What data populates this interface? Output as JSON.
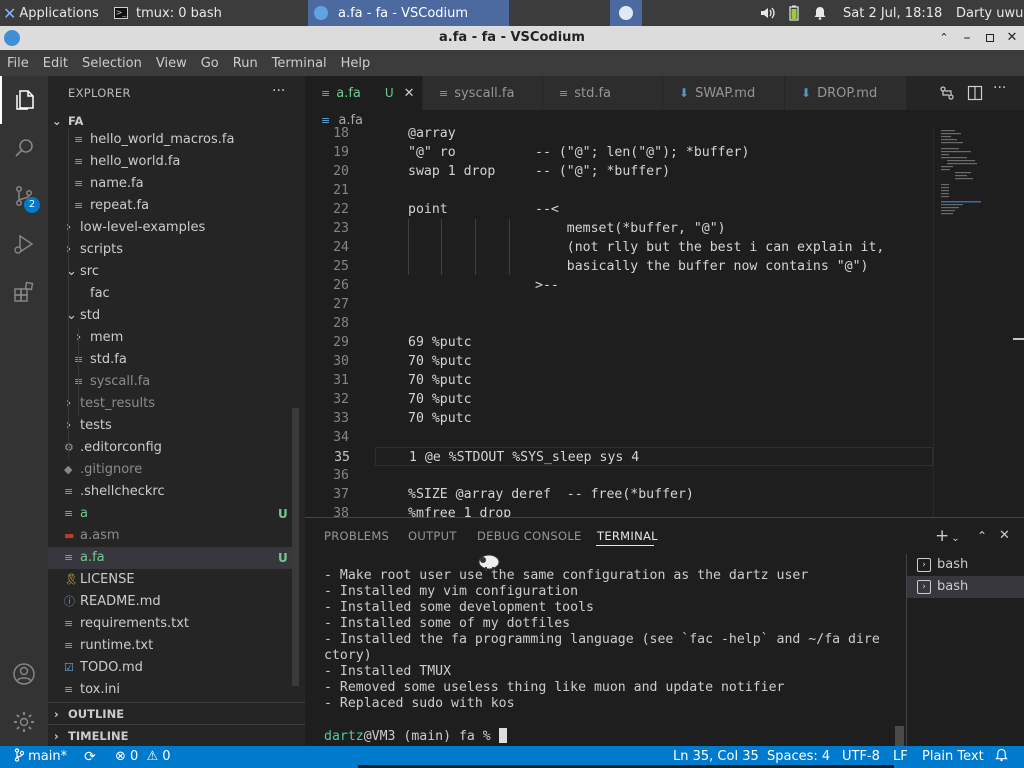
{
  "taskbar": {
    "applications_label": "Applications",
    "tmux_task": "tmux: 0 bash",
    "vscodium_task": "a.fa - fa - VSCodium",
    "datetime": "Sat  2 Jul, 18:18",
    "user": "Darty uwu"
  },
  "window": {
    "title": "a.fa - fa - VSCodium"
  },
  "menu": [
    "File",
    "Edit",
    "Selection",
    "View",
    "Go",
    "Run",
    "Terminal",
    "Help"
  ],
  "activity_bar": {
    "scm_badge": "2"
  },
  "explorer": {
    "header": "EXPLORER",
    "more": "···",
    "root": "FA",
    "items": [
      {
        "label": "hello_world_macros.fa",
        "indent": 2,
        "kind": "file",
        "icon": "list-icon",
        "color": "#cccccc",
        "badge": ""
      },
      {
        "label": "hello_world.fa",
        "indent": 2,
        "kind": "file",
        "icon": "list-icon",
        "color": "#cccccc",
        "badge": ""
      },
      {
        "label": "name.fa",
        "indent": 2,
        "kind": "file",
        "icon": "list-icon",
        "color": "#cccccc",
        "badge": ""
      },
      {
        "label": "repeat.fa",
        "indent": 2,
        "kind": "file",
        "icon": "list-icon",
        "color": "#cccccc",
        "badge": ""
      },
      {
        "label": "low-level-examples",
        "indent": 1,
        "kind": "folder-closed",
        "icon": "",
        "color": "#cccccc",
        "badge": ""
      },
      {
        "label": "scripts",
        "indent": 1,
        "kind": "folder-closed",
        "icon": "",
        "color": "#cccccc",
        "badge": ""
      },
      {
        "label": "src",
        "indent": 1,
        "kind": "folder-open",
        "icon": "",
        "color": "#cccccc",
        "badge": ""
      },
      {
        "label": "fac",
        "indent": 2,
        "kind": "file",
        "icon": "",
        "color": "#cccccc",
        "badge": ""
      },
      {
        "label": "std",
        "indent": 1,
        "kind": "folder-open",
        "icon": "",
        "color": "#cccccc",
        "badge": ""
      },
      {
        "label": "mem",
        "indent": 2,
        "kind": "folder-closed",
        "icon": "",
        "color": "#cccccc",
        "badge": ""
      },
      {
        "label": "std.fa",
        "indent": 2,
        "kind": "file",
        "icon": "list-icon",
        "color": "#cccccc",
        "badge": ""
      },
      {
        "label": "syscall.fa",
        "indent": 2,
        "kind": "file",
        "icon": "list-icon",
        "color": "#8c8c8c",
        "badge": ""
      },
      {
        "label": "test_results",
        "indent": 1,
        "kind": "folder-closed",
        "icon": "",
        "color": "#8c8c8c",
        "badge": ""
      },
      {
        "label": "tests",
        "indent": 1,
        "kind": "folder-closed",
        "icon": "",
        "color": "#cccccc",
        "badge": ""
      },
      {
        "label": ".editorconfig",
        "indent": 1,
        "kind": "file",
        "icon": "gear-icon",
        "color": "#cccccc",
        "badge": ""
      },
      {
        "label": ".gitignore",
        "indent": 1,
        "kind": "file",
        "icon": "git-icon",
        "color": "#8c8c8c",
        "badge": ""
      },
      {
        "label": ".shellcheckrc",
        "indent": 1,
        "kind": "file",
        "icon": "list-icon",
        "color": "#cccccc",
        "badge": ""
      },
      {
        "label": "a",
        "indent": 1,
        "kind": "file",
        "icon": "list-icon",
        "color": "#73c991",
        "badge": "U"
      },
      {
        "label": "a.asm",
        "indent": 1,
        "kind": "file",
        "icon": "asm-icon",
        "color": "#8c8c8c",
        "badge": ""
      },
      {
        "label": "a.fa",
        "indent": 1,
        "kind": "file",
        "icon": "list-icon",
        "color": "#73c991",
        "badge": "U",
        "selected": true
      },
      {
        "label": "LICENSE",
        "indent": 1,
        "kind": "file",
        "icon": "license-icon",
        "color": "#cccccc",
        "badge": ""
      },
      {
        "label": "README.md",
        "indent": 1,
        "kind": "file",
        "icon": "info-icon",
        "color": "#cccccc",
        "badge": ""
      },
      {
        "label": "requirements.txt",
        "indent": 1,
        "kind": "file",
        "icon": "list-icon",
        "color": "#cccccc",
        "badge": ""
      },
      {
        "label": "runtime.txt",
        "indent": 1,
        "kind": "file",
        "icon": "list-icon",
        "color": "#cccccc",
        "badge": ""
      },
      {
        "label": "TODO.md",
        "indent": 1,
        "kind": "file",
        "icon": "todo-icon",
        "color": "#cccccc",
        "badge": ""
      },
      {
        "label": "tox.ini",
        "indent": 1,
        "kind": "file",
        "icon": "list-icon",
        "color": "#cccccc",
        "badge": ""
      }
    ],
    "outline": "OUTLINE",
    "timeline": "TIMELINE"
  },
  "tabs": [
    {
      "label": "a.fa",
      "badge": "U",
      "active": true
    },
    {
      "label": "syscall.fa",
      "badge": "",
      "active": false
    },
    {
      "label": "std.fa",
      "badge": "",
      "active": false
    },
    {
      "label": "SWAP.md",
      "badge": "",
      "active": false
    },
    {
      "label": "DROP.md",
      "badge": "",
      "active": false
    }
  ],
  "breadcrumb": "a.fa",
  "code": [
    {
      "n": "18",
      "t": "@array"
    },
    {
      "n": "19",
      "t": "\"@\" ro          -- (\"@\"; len(\"@\"); *buffer)"
    },
    {
      "n": "20",
      "t": "swap 1 drop     -- (\"@\"; *buffer)"
    },
    {
      "n": "21",
      "t": ""
    },
    {
      "n": "22",
      "t": "point           --<"
    },
    {
      "n": "23",
      "t": "                    memset(*buffer, \"@\")"
    },
    {
      "n": "24",
      "t": "                    (not rlly but the best i can explain it,"
    },
    {
      "n": "25",
      "t": "                    basically the buffer now contains \"@\")"
    },
    {
      "n": "26",
      "t": "                >--"
    },
    {
      "n": "27",
      "t": ""
    },
    {
      "n": "28",
      "t": ""
    },
    {
      "n": "29",
      "t": "69 %putc"
    },
    {
      "n": "30",
      "t": "70 %putc"
    },
    {
      "n": "31",
      "t": "70 %putc"
    },
    {
      "n": "32",
      "t": "70 %putc"
    },
    {
      "n": "33",
      "t": "70 %putc"
    },
    {
      "n": "34",
      "t": ""
    },
    {
      "n": "35",
      "t": "1 @e %STDOUT %SYS_sleep sys 4"
    },
    {
      "n": "36",
      "t": ""
    },
    {
      "n": "37",
      "t": "%SIZE @array deref  -- free(*buffer)"
    },
    {
      "n": "38",
      "t": "%mfree 1 drop"
    }
  ],
  "panel": {
    "tabs": [
      "PROBLEMS",
      "OUTPUT",
      "DEBUG CONSOLE",
      "TERMINAL"
    ],
    "active_tab": "TERMINAL",
    "terminal_lines": [
      "- Make root user use the same configuration as the dartz user",
      "- Installed my vim configuration",
      "- Installed some development tools",
      "- Installed some of my dotfiles",
      "- Installed the fa programming language (see `fac -help` and ~/fa dire",
      "ctory)",
      "- Installed TMUX",
      "- Removed some useless thing like muon and update notifier",
      "- Replaced sudo with kos"
    ],
    "prompt_user": "dartz",
    "prompt_rest": "@VM3 (main) fa % ",
    "terminals": [
      "bash",
      "bash"
    ]
  },
  "status": {
    "branch": "main*",
    "errors": "0",
    "warnings": "0",
    "position": "Ln 35, Col 35",
    "spaces": "Spaces: 4",
    "encoding": "UTF-8",
    "eol": "LF",
    "language": "Plain Text"
  },
  "colors": {
    "accent": "#007acc",
    "untracked": "#73c991",
    "prompt_user": "#4ec9b0"
  }
}
